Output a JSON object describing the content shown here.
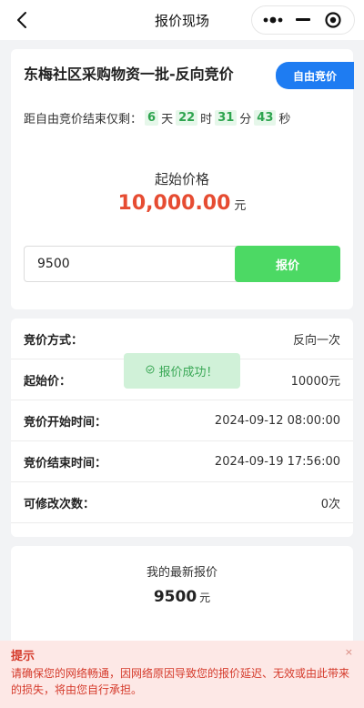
{
  "header": {
    "title": "报价现场"
  },
  "auction": {
    "name": "东梅社区采购物资一批-反向竞价",
    "tag": "自由竞价",
    "countdown_label": "距自由竞价结束仅剩：",
    "days": "6",
    "days_unit": "天",
    "hours": "22",
    "hours_unit": "时",
    "minutes": "31",
    "minutes_unit": "分",
    "seconds": "43",
    "seconds_unit": "秒",
    "start_price_label": "起始价格",
    "start_price": "10,000.00",
    "currency_unit": "元"
  },
  "bid": {
    "value": "9500",
    "button_label": "报价"
  },
  "details": [
    {
      "label": "竞价方式：",
      "value": "反向一次"
    },
    {
      "label": "起始价：",
      "value": "10000元"
    },
    {
      "label": "竞价开始时间：",
      "value": "2024-09-12 08:00:00"
    },
    {
      "label": "竞价结束时间：",
      "value": "2024-09-19 17:56:00"
    },
    {
      "label": "可修改次数：",
      "value": "0次"
    }
  ],
  "toast": {
    "text": "报价成功！"
  },
  "latest_bid": {
    "label": "我的最新报价",
    "value": "9500",
    "unit": "元"
  },
  "notice": {
    "title": "提示",
    "body": "请确保您的网络畅通，因网络原因导致您的报价延迟、无效或由此带来的损失，将由您自行承担。",
    "close_glyph": "×"
  },
  "colors": {
    "accent_blue": "#1e7cf2",
    "accent_green": "#4cd964",
    "price_red": "#e64c32",
    "notice_bg": "#fde8e6"
  }
}
